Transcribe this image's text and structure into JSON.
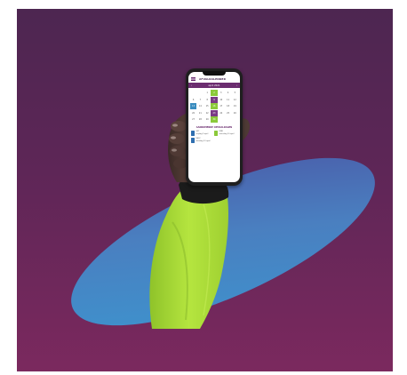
{
  "app": {
    "title": "AFVALKALENDER",
    "month": "april 2021"
  },
  "calendar": {
    "days": [
      "",
      "",
      "1",
      "2",
      "3",
      "4",
      "5",
      "6",
      "7",
      "8",
      "9",
      "10",
      "11",
      "12",
      "13",
      "14",
      "15",
      "16",
      "17",
      "18",
      "19",
      "20",
      "21",
      "22",
      "23",
      "24",
      "25",
      "26",
      "27",
      "28",
      "29",
      "30",
      "",
      "",
      ""
    ],
    "highlight": {
      "3": "green",
      "10": "purple",
      "14": "blue",
      "17": "green",
      "24": "purple",
      "31": "green"
    }
  },
  "schedule": {
    "title": "AANKOMENDE OPHAALDAGEN",
    "bins": [
      {
        "label": "GFT",
        "date": "vrijdag 9 april",
        "color": "#2f6fb0"
      },
      {
        "label": "PMD",
        "date": "zaterdag 10 april",
        "color": "#8bc93a"
      },
      {
        "label": "REST",
        "date": "dinsdag 13 april",
        "color": "#2f6fb0"
      }
    ]
  },
  "colors": {
    "background_top": "#4d2651",
    "background_bottom": "#7b295e",
    "ellipse_left": "#3c95cf",
    "ellipse_right": "#4a58a6",
    "sleeve": "#a9dc35"
  }
}
